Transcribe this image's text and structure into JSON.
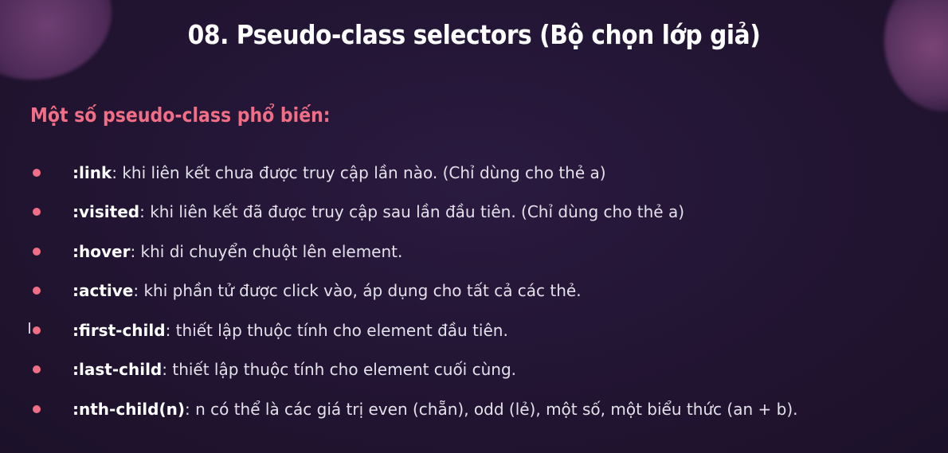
{
  "slide": {
    "title": "08. Pseudo-class selectors (Bộ chọn lớp giả)",
    "subtitle": "Một số pseudo-class phổ biến:",
    "items": [
      {
        "term": ":link",
        "desc": ": khi liên kết chưa được truy cập lần nào. (Chỉ dùng cho thẻ a)"
      },
      {
        "term": ":visited",
        "desc": ": khi liên kết đã được truy cập sau lần đầu tiên. (Chỉ dùng cho thẻ a)"
      },
      {
        "term": ":hover",
        "desc": ": khi di chuyển chuột lên element."
      },
      {
        "term": ":active",
        "desc": ": khi phần tử được click vào, áp dụng cho tất cả các thẻ."
      },
      {
        "term": ":first-child",
        "desc": ": thiết lập thuộc tính cho element đầu tiên."
      },
      {
        "term": ":last-child",
        "desc": ": thiết lập thuộc tính cho element cuối cùng."
      },
      {
        "term": ":nth-child(n)",
        "desc": ": n có thể là các giá trị even (chẵn), odd (lẻ), một số, một biểu thức (an + b)."
      }
    ]
  },
  "colors": {
    "background": "#221533",
    "accent": "#f06e86",
    "text": "#ffffff"
  },
  "icons": {
    "bullet": "pink-dot-icon",
    "cursor": "text-cursor-icon"
  }
}
